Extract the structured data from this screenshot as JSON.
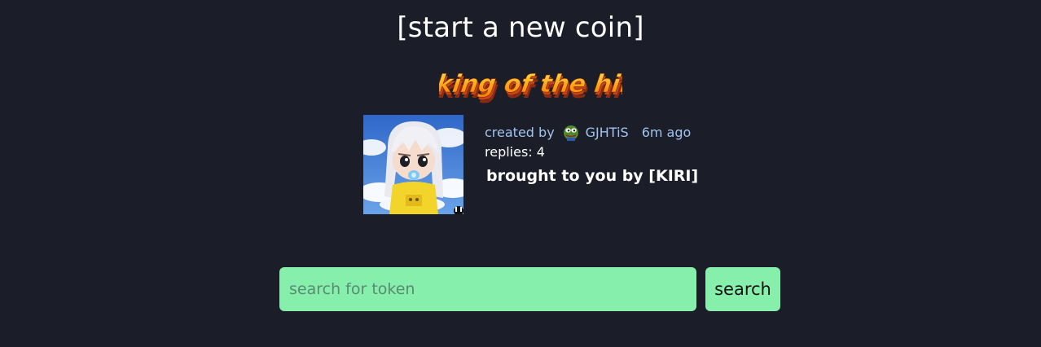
{
  "header": {
    "start_link": "[start a new coin]"
  },
  "king_of_the_hill": {
    "label": "king of the hill",
    "colors": [
      "#ffd21a",
      "#ff8a00",
      "#c4451a"
    ]
  },
  "featured": {
    "created_by_label": "created by",
    "creator": "GJHTiS",
    "time_ago": "6m ago",
    "replies": "replies: 4",
    "description": "brought to you by [KIRI]",
    "avatar_icon": "pepe-avatar-icon"
  },
  "search": {
    "placeholder": "search for token",
    "value": "",
    "button_label": "search"
  },
  "colors": {
    "background": "#1b1d28",
    "accent": "#86efac",
    "link": "#9fc4f0"
  }
}
